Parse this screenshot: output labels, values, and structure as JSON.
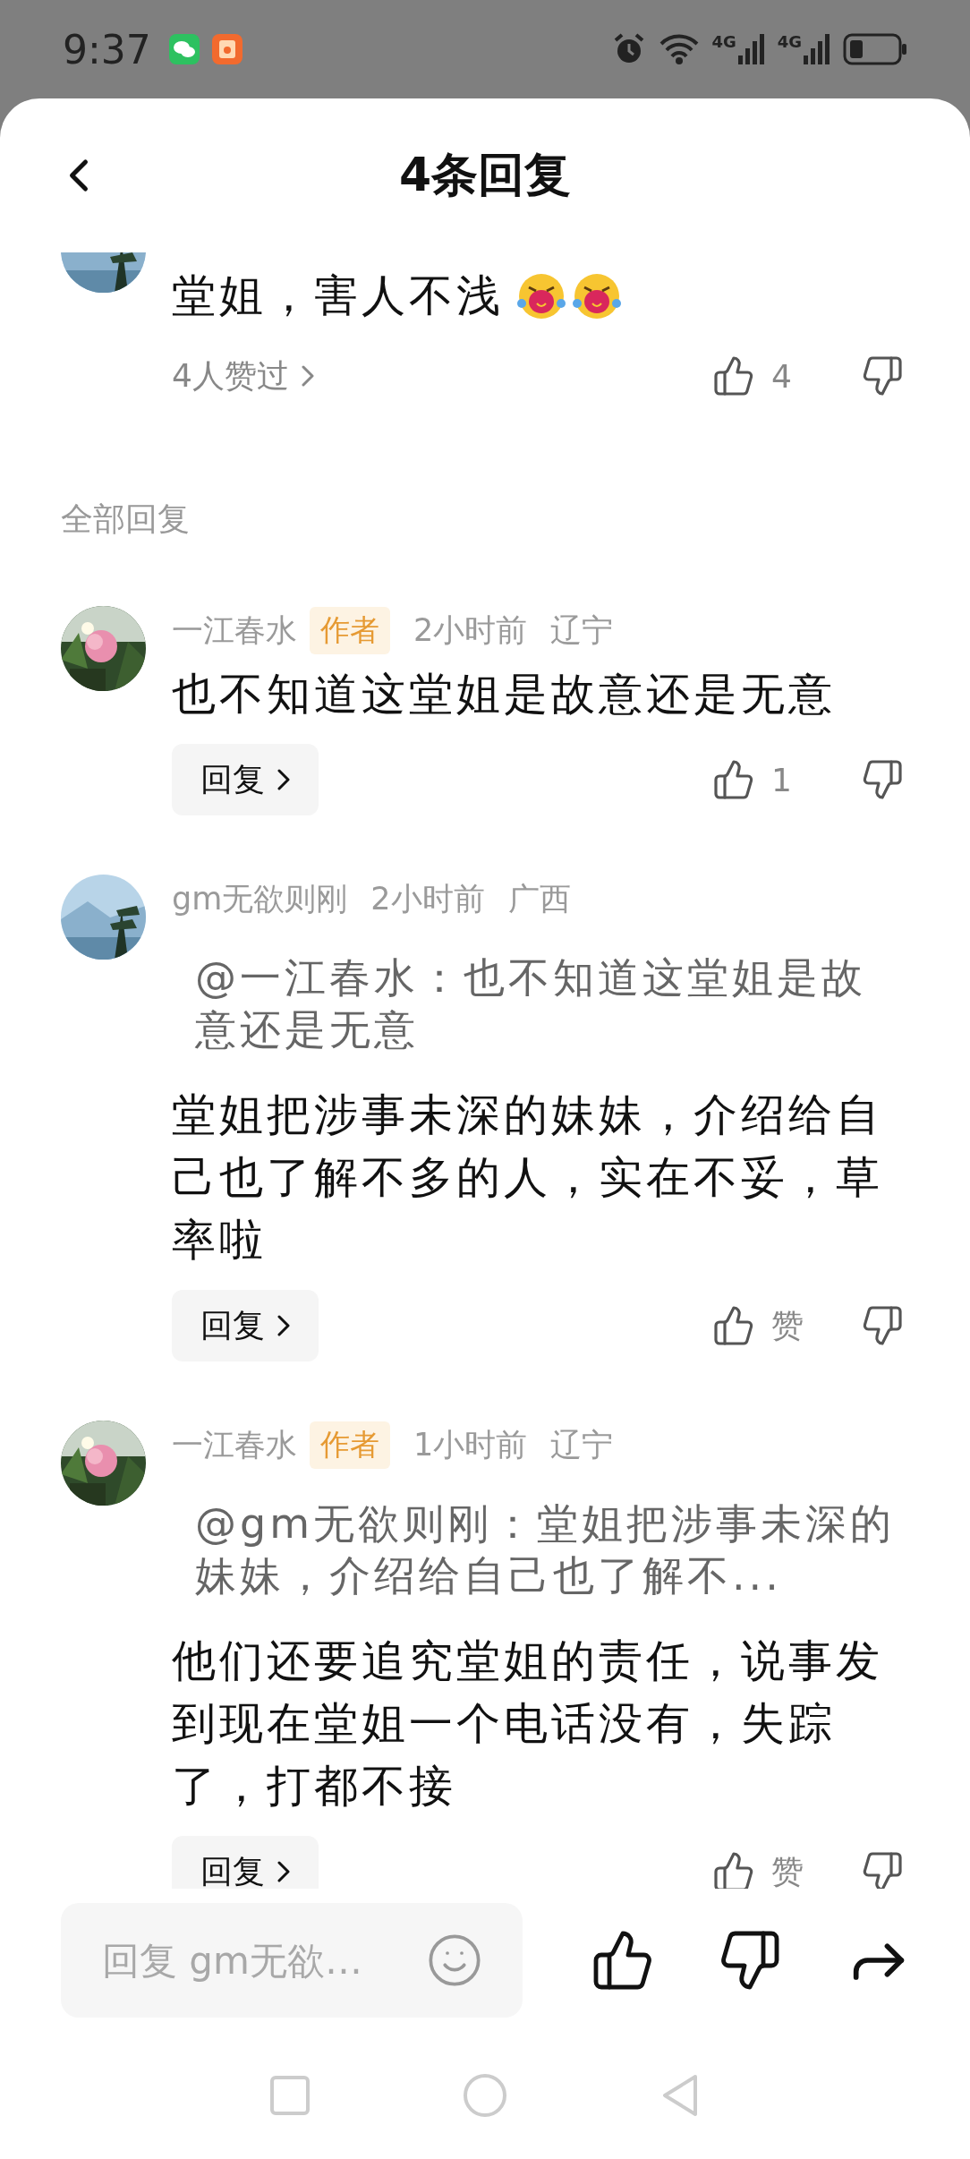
{
  "status_bar": {
    "time": "9:37",
    "network": [
      "4G",
      "4G"
    ]
  },
  "header": {
    "title": "4条回复"
  },
  "main_comment": {
    "text": "堂姐，害人不浅",
    "liked_by": "4人赞过",
    "likes": "4"
  },
  "section_label": "全部回复",
  "replies": [
    {
      "author": "一江春水",
      "badge": "作者",
      "time": "2小时前",
      "location": "辽宁",
      "text": "也不知道这堂姐是故意还是无意",
      "reply_button": "回复",
      "likes": "1"
    },
    {
      "author": "gm无欲则刚",
      "time": "2小时前",
      "location": "广西",
      "quote": "@一江春水：也不知道这堂姐是故意还是无意",
      "text": "堂姐把涉事未深的妹妹，介绍给自己也了解不多的人，实在不妥，草率啦",
      "reply_button": "回复",
      "likes": "赞"
    },
    {
      "author": "一江春水",
      "badge": "作者",
      "time": "1小时前",
      "location": "辽宁",
      "quote": "@gm无欲则刚：堂姐把涉事未深的妹妹，介绍给自己也了解不...",
      "text": "他们还要追究堂姐的责任，说事发到现在堂姐一个电话没有，失踪了，打都不接",
      "reply_button": "回复",
      "likes": "赞"
    }
  ],
  "composer": {
    "placeholder": "回复 gm无欲…"
  }
}
